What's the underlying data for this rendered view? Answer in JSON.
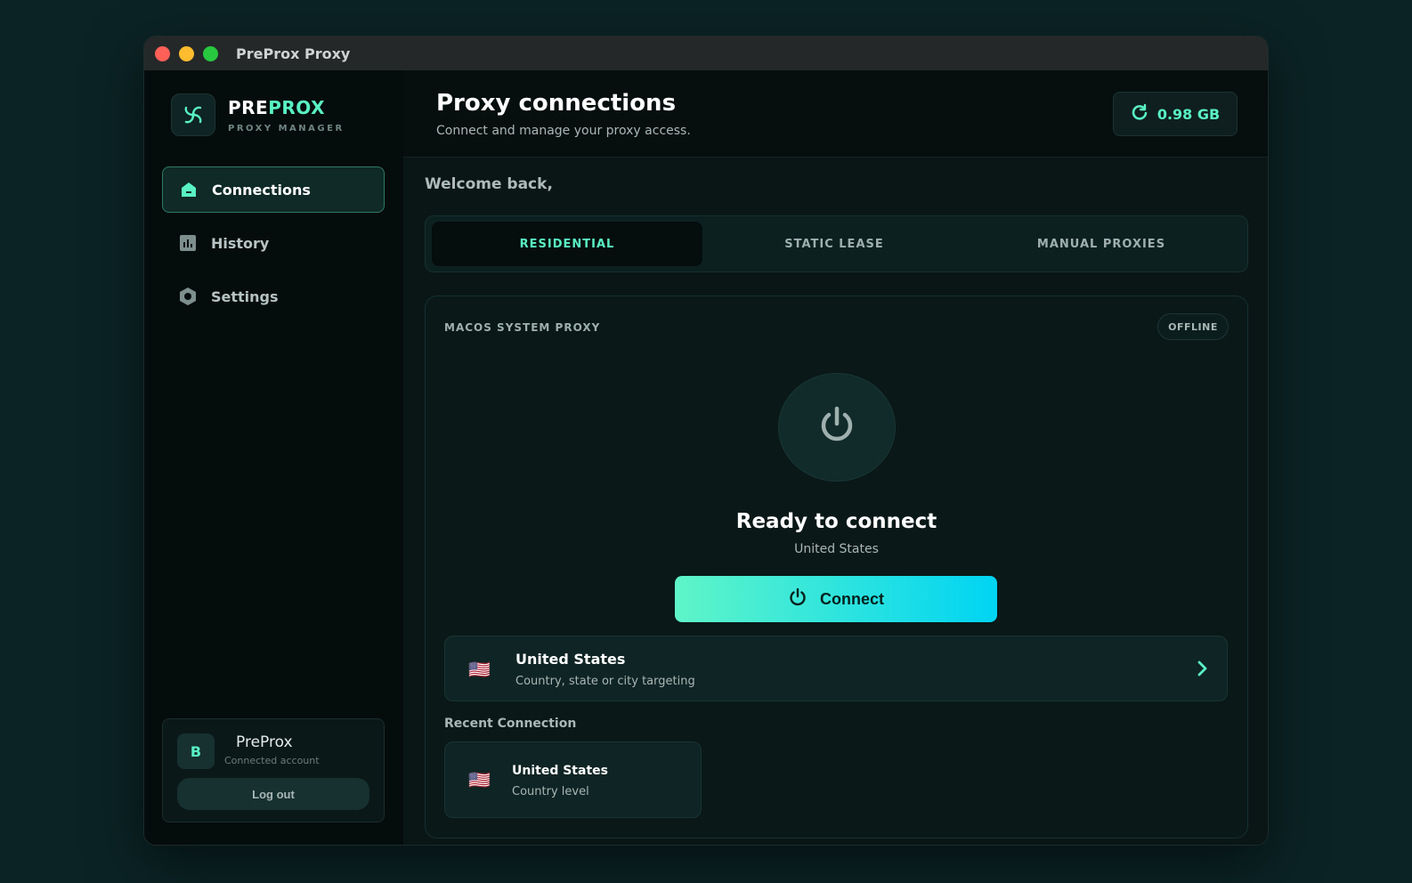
{
  "window": {
    "title": "PreProx Proxy"
  },
  "brand": {
    "name_pre": "PRE",
    "name_prox": "PROX",
    "subtitle": "PROXY MANAGER",
    "accent": "#59f2c3"
  },
  "sidebar": {
    "items": [
      {
        "label": "Connections",
        "icon": "home-icon",
        "active": true
      },
      {
        "label": "History",
        "icon": "chart-icon",
        "active": false
      },
      {
        "label": "Settings",
        "icon": "gear-icon",
        "active": false
      }
    ]
  },
  "account": {
    "avatar_initial": "B",
    "name": "PreProx",
    "status": "Connected account",
    "logout_label": "Log out"
  },
  "header": {
    "title": "Proxy connections",
    "subtitle": "Connect and manage your proxy access.",
    "usage": "0.98 GB"
  },
  "welcome": "Welcome back,",
  "tabs": [
    {
      "label": "RESIDENTIAL",
      "active": true
    },
    {
      "label": "STATIC LEASE",
      "active": false
    },
    {
      "label": "MANUAL PROXIES",
      "active": false
    }
  ],
  "proxy_panel": {
    "label": "MACOS SYSTEM PROXY",
    "status": "OFFLINE",
    "ready_title": "Ready to connect",
    "ready_location": "United States",
    "connect_label": "Connect",
    "location": {
      "name": "United States",
      "description": "Country, state or city targeting",
      "flag": "🇺🇸"
    }
  },
  "recent": {
    "label": "Recent Connection",
    "items": [
      {
        "name": "United States",
        "level": "Country level",
        "flag": "🇺🇸"
      }
    ]
  }
}
